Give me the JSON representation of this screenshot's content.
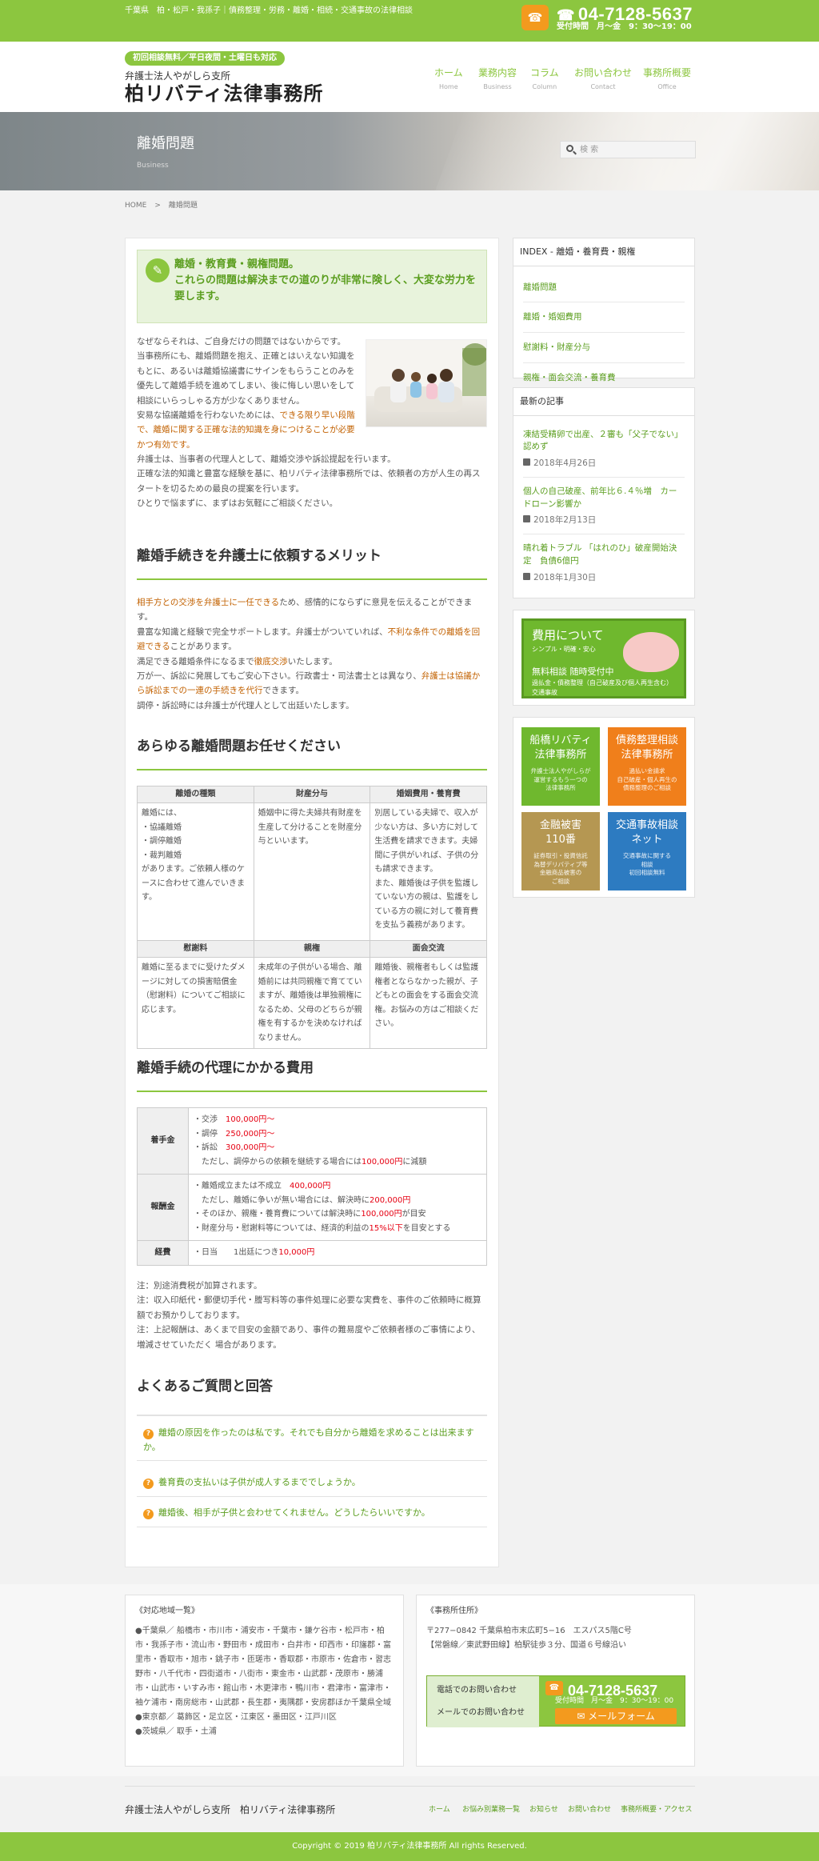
{
  "topbar": {
    "tagline": "千葉県　柏・松戸・我孫子｜債務整理・労務・離婚・相続・交通事故の法律相談",
    "tel": "04-7128-5637",
    "hours": "受付時間　月〜金　9：30〜19：00"
  },
  "header": {
    "badge": "初回相談無料／平日夜間・土曜日も対応",
    "branch": "弁護士法人やがしら支所",
    "firm": "柏リバティ法律事務所",
    "nav": [
      {
        "label": "ホーム",
        "en": "Home"
      },
      {
        "label": "業務内容",
        "en": "Business"
      },
      {
        "label": "コラム",
        "en": "Column"
      },
      {
        "label": "お問い合わせ",
        "en": "Contact"
      },
      {
        "label": "事務所概要",
        "en": "Office"
      }
    ]
  },
  "hero": {
    "title": "離婚問題",
    "subtitle": "Business",
    "search_placeholder": "検 索"
  },
  "breadcrumb": {
    "home": "HOME",
    "sep": ">",
    "current": "離婚問題"
  },
  "lead": {
    "line1": "離婚・教育費・親権問題。",
    "line2": "これらの問題は解決までの道のりが非常に険しく、大変な労力を要します。"
  },
  "intro": {
    "p1": "なぜならそれは、ご自身だけの問題ではないからです。",
    "p2": "当事務所にも、離婚問題を抱え、正確とはいえない知識をもとに、あるいは離婚協議書にサインをもらうことのみを優先して離婚手続を進めてしまい、後に悔しい思いをして相談にいらっしゃる方が少なくありません。",
    "p3a": "安易な協議離婚を行わないためには、",
    "p3b": "できる限り早い段階で、離婚に関する正確な法的知識を身につけることが必要かつ有効です。",
    "p4": "弁護士は、当事者の代理人として、離婚交渉や訴訟提起を行います。",
    "p5": "正確な法的知識と豊富な経験を基に、柏リバティ法律事務所では、依頼者の方が人生の再スタートを切るための最良の提案を行います。",
    "p6": "ひとりで悩まずに、まずはお気軽にご相談ください。"
  },
  "merit": {
    "heading": "離婚手続きを弁護士に依頼するメリット",
    "s1a": "相手方との交渉を弁護士に一任できる",
    "s1b": "ため、感情的にならずに意見を伝えることができます。",
    "s2a": "豊富な知識と経験で完全サポートします。弁護士がついていれば、",
    "s2b": "不利な条件での離婚を回避できる",
    "s2c": "ことがあります。",
    "s3a": "満足できる離婚条件になるまで",
    "s3b": "徹底交渉",
    "s3c": "いたします。",
    "s4a": "万が一、訴訟に発展してもご安心下さい。行政書士・司法書士とは異なり、",
    "s4b": "弁護士は協議から訴訟までの一連の手続きを代行",
    "s4c": "できます。",
    "s5": "調停・訴訟時には弁護士が代理人として出廷いたします。"
  },
  "types": {
    "heading": "あらゆる離婚問題お任せください",
    "row1_headers": [
      "離婚の種類",
      "財産分与",
      "婚姻費用・養育費"
    ],
    "row1_cells": [
      "離婚には、\n・協議離婚\n・調停離婚\n・裁判離婚\nがあります。ご依頼人様のケースに合わせて進んでいきます。",
      "婚姻中に得た夫婦共有財産を生産して分けることを財産分与といいます。",
      "別居している夫婦で、収入が少ない方は、多い方に対して生活費を請求できます。夫婦間に子供がいれば、子供の分も請求できます。\nまた、離婚後は子供を監護していない方の親は、監護をしている方の親に対して養育費を支払う義務があります。"
    ],
    "row2_headers": [
      "慰謝料",
      "親権",
      "面会交流"
    ],
    "row2_cells": [
      "離婚に至るまでに受けたダメージに対しての損害賠償金（慰謝料）についてご相談に応じます。",
      "未成年の子供がいる場合、離婚前には共同親権で育てていますが、離婚後は単独親権になるため、父母のどちらが親権を有するかを決めなければなりません。",
      "離婚後、親権者もしくは監護権者とならなかった親が、子どもとの面会をする面会交流権。お悩みの方はご相談ください。"
    ]
  },
  "fees": {
    "heading": "離婚手続の代理にかかる費用",
    "retainer": {
      "label": "着手金",
      "l1a": "・交渉",
      "l1b": "100,000円〜",
      "l2a": "・調停",
      "l2b": "250,000円〜",
      "l3a": "・訴訟",
      "l3b": "300,000円〜",
      "l4a": "ただし、調停からの依頼を継続する場合には",
      "l4b": "100,000円",
      "l4c": "に減額"
    },
    "reward": {
      "label": "報酬金",
      "l1a": "・離婚成立または不成立",
      "l1b": "400,000円",
      "l2a": "ただし、離婚に争いが無い場合には、解決時に",
      "l2b": "200,000円",
      "l3a": "・そのほか、親権・養育費については解決時に",
      "l3b": "100,000円",
      "l3c": "が目安",
      "l4a": "・財産分与・慰謝料等については、経済的利益の",
      "l4b": "15%以下",
      "l4c": "を目安とする"
    },
    "expense": {
      "label": "経費",
      "l1a": "・日当　　1出廷につき",
      "l1b": "10,000円"
    },
    "notes": [
      "注：別途消費税が加算されます。",
      "注：収入印紙代・郵便切手代・謄写料等の事件処理に必要な実費を、事件のご依頼時に概算額でお預かりしております。",
      "注：上記報酬は、あくまで目安の金額であり、事件の難易度やご依頼者様のご事情により、増減させていただく 場合があります。"
    ]
  },
  "faq": {
    "heading": "よくあるご質問と回答",
    "mark": "?",
    "items": [
      "離婚の原因を作ったのは私です。それでも自分から離婚を求めることは出来ますか。",
      "養育費の支払いは子供が成人するまででしょうか。",
      "離婚後、相手が子供と会わせてくれません。どうしたらいいですか。"
    ]
  },
  "sidebar": {
    "index": {
      "title": "INDEX - 離婚・養育費・親権",
      "items": [
        "離婚問題",
        "離婚・婚姻費用",
        "慰謝料・財産分与",
        "親権・面会交流・養育費"
      ]
    },
    "news": {
      "title": "最新の記事",
      "items": [
        {
          "title": "凍結受精卵で出産、２審も「父子でない」認めず",
          "date": "2018年4月26日"
        },
        {
          "title": "個人の自己破産、前年比６.４％増　カードローン影響か",
          "date": "2018年2月13日"
        },
        {
          "title": "晴れ着トラブル 「はれのひ」破産開始決定　負債6億円",
          "date": "2018年1月30日"
        }
      ]
    },
    "fee_banner": {
      "title": "費用について",
      "sub": "シンプル・明確・安心",
      "line1": "無料相談 随時受付中",
      "line2": "過払金・債務整理（自己破産及び個人再生含む）交通事故"
    },
    "banners": [
      {
        "title": "船橋リバティ\n法律事務所",
        "sub": "弁護士法人やがしらが\n運営するもう一つの\n法律事務所",
        "color": "#6fb82e"
      },
      {
        "title": "債務整理相談\n法律事務所",
        "sub": "過払い金請求\n自己破産・個人再生の\n債務整理のご相談",
        "color": "#f07f1b"
      },
      {
        "title": "金融被害\n110番",
        "sub": "証券取引・投資信託\n為替デリバティブ等\n金融商品被害の\nご相談",
        "color": "#b59752"
      },
      {
        "title": "交通事故相談\nネット",
        "sub": "交通事故に関する\n相談\n初回相談無料",
        "color": "#2d7bc1"
      }
    ]
  },
  "area": {
    "title": "《対応地域一覧》",
    "chiba": "●千葉県／ 船橋市・市川市・浦安市・千葉市・鎌ケ谷市・松戸市・柏市・我孫子市・流山市・野田市・成田市・白井市・印西市・印旛郡・富里市・香取市・旭市・銚子市・匝瑳市・香取郡・市原市・佐倉市・習志野市・八千代市・四街道市・八街市・東金市・山武郡・茂原市・勝浦市・山武市・いすみ市・館山市・木更津市・鴨川市・君津市・富津市・袖ケ浦市・南房総市・山武郡・長生郡・夷隅郡・安房郡ほか千葉県全域",
    "tokyo": "●東京都／ 葛飾区・足立区・江東区・墨田区・江戸川区",
    "ibaraki": "●茨城県／ 取手・土浦"
  },
  "office": {
    "title": "《事務所住所》",
    "addr1": "〒277−0842 千葉県柏市末広町5−16　エスパス5階C号",
    "addr2": "【常磐線／東武野田線】柏駅徒歩３分、国道６号線沿い",
    "phone_label": "電話でのお問い合わせ",
    "mail_label": "メールでのお問い合わせ",
    "tel": "04-7128-5637",
    "hours": "受付時間　月〜金　9：30〜19：00",
    "mail_button": "メールフォーム"
  },
  "footer": {
    "firm": "弁護士法人やがしら支所　柏リバティ法律事務所",
    "links": [
      "ホーム",
      "お悩み別業務一覧",
      "お知らせ",
      "お問い合わせ",
      "事務所概要・アクセス"
    ],
    "copyright": "Copyright © 2019 柏リバティ法律事務所 All rights Reserved."
  }
}
